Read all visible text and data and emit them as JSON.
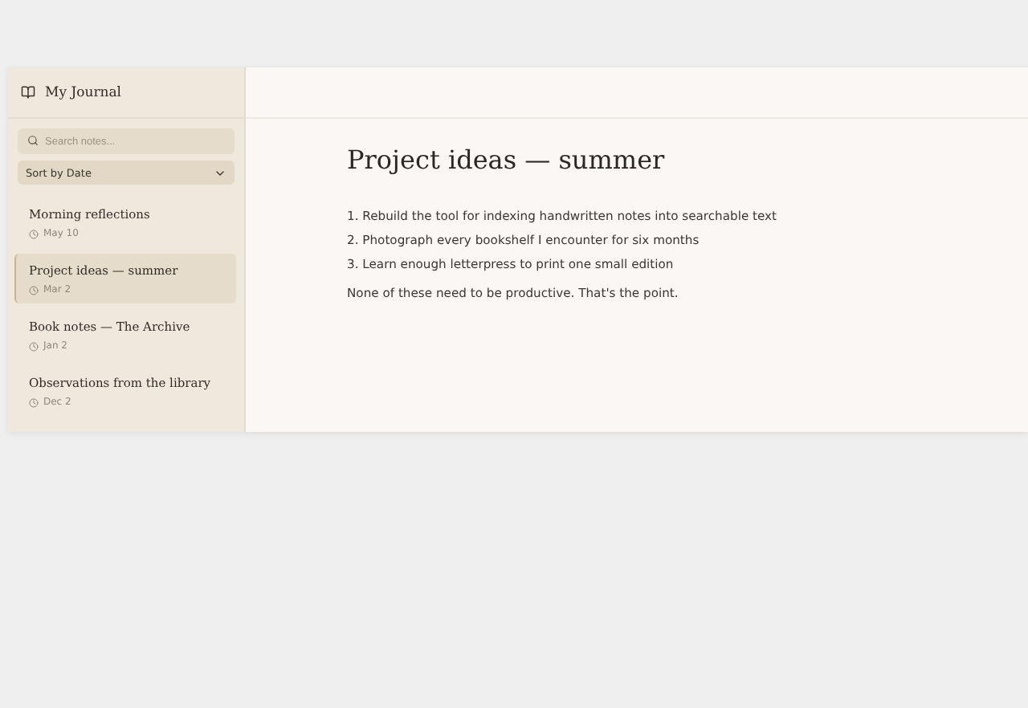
{
  "sidebar": {
    "title": "My Journal",
    "search": {
      "placeholder": "Search notes..."
    },
    "sort": {
      "value": "Sort by Date"
    },
    "notes": [
      {
        "title": "Morning reflections",
        "date": "May 10",
        "selected": false
      },
      {
        "title": "Project ideas — summer",
        "date": "Mar 2",
        "selected": true
      },
      {
        "title": "Book notes — The Archive",
        "date": "Jan 2",
        "selected": false
      },
      {
        "title": "Observations from the library",
        "date": "Dec 2",
        "selected": false
      }
    ]
  },
  "note": {
    "title": "Project ideas — summer",
    "list": [
      "1. Rebuild the tool for indexing handwritten notes into searchable text",
      "2. Photograph every bookshelf I encounter for six months",
      "3. Learn enough letterpress to print one small edition"
    ],
    "paragraph": "None of these need to be productive. That's the point."
  }
}
